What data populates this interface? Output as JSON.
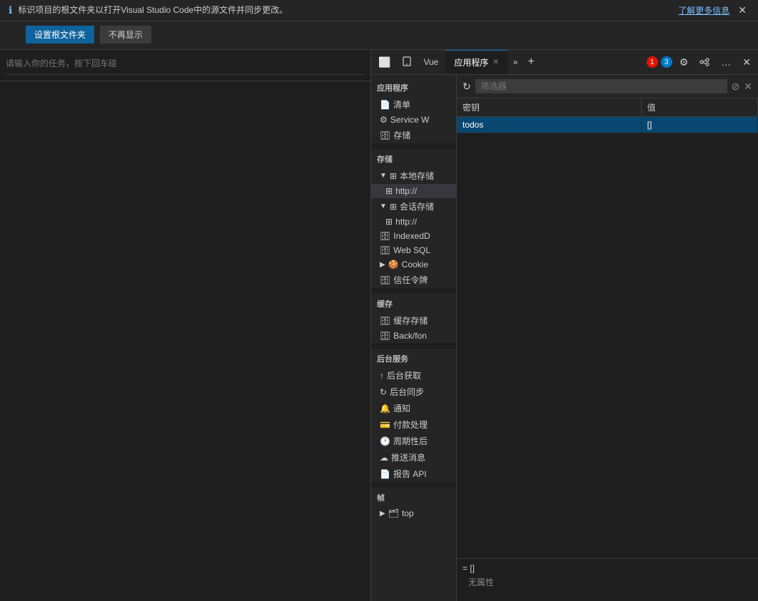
{
  "notification": {
    "icon": "ℹ",
    "text": "标识项目的根文件夹以打开Visual Studio Code中的源文件并同步更改。",
    "link_text": "了解更多信息",
    "close_icon": "✕",
    "btn_primary": "设置根文件夹",
    "btn_secondary": "不再显示"
  },
  "tabbar": {
    "icon_screencast": "⬜",
    "icon_mobile": "📱",
    "label_vue": "Vue",
    "tab_active": "应用程序",
    "tab_close": "✕",
    "overflow": "»",
    "add": "+",
    "badge_red_count": "1",
    "badge_blue_count": "3",
    "icon_settings": "⚙",
    "icon_connections": "⚯",
    "icon_more": "…",
    "icon_close": "✕"
  },
  "sidebar": {
    "section_app": "应用程序",
    "item_list": "清单",
    "item_service": "Service W",
    "item_storage_s": "存储",
    "section_storage": "存储",
    "item_local_storage": "本地存储",
    "item_local_http": "http://",
    "item_session_storage": "会话存储",
    "item_session_http": "http://",
    "item_indexed_db": "IndexedD",
    "item_web_sql": "Web SQL",
    "item_cookie": "Cookie",
    "item_trusted": "信任令牌",
    "section_cache": "缓存",
    "item_cache_storage": "缓存存储",
    "item_back_forward": "Back/fon",
    "section_background": "后台服务",
    "item_bg_fetch": "后台获取",
    "item_bg_sync": "后台同步",
    "item_notifications": "通知",
    "item_payment": "付款处理",
    "item_periodic": "周期性后",
    "item_push": "推送消息",
    "item_report": "报告 API",
    "section_frames": "帧",
    "item_top": "top"
  },
  "filter": {
    "refresh_icon": "↻",
    "placeholder": "筛选器",
    "clear_icon": "⊘",
    "close_icon": "✕"
  },
  "table": {
    "col_key": "密钥",
    "col_value": "值",
    "rows": [
      {
        "key": "todos",
        "value": "[]",
        "selected": true
      }
    ]
  },
  "preview": {
    "label": "= []",
    "empty_text": "无属性"
  },
  "left_panel": {
    "input_placeholder": "请输入你的任务，按下回车碰"
  }
}
